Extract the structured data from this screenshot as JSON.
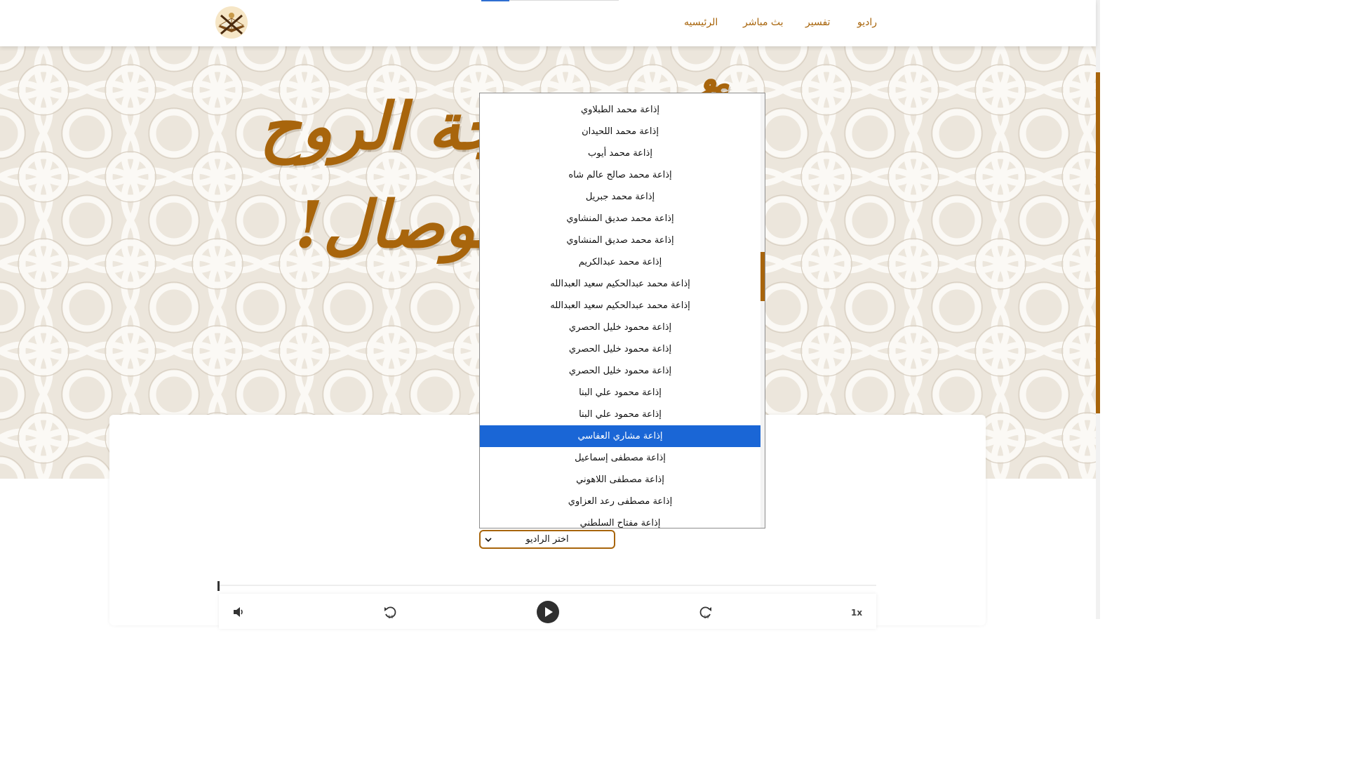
{
  "nav": {
    "items": [
      {
        "label": "راديو"
      },
      {
        "label": "تفسير"
      },
      {
        "label": "بث مباشر"
      },
      {
        "label": "الرئيسيه"
      }
    ]
  },
  "hero": {
    "line1": "أيُّها المُهجة الروح",
    "line2": "وا للوصال!"
  },
  "select": {
    "label": "اختر الراديو"
  },
  "dropdown": {
    "options": [
      "إذاعة محمد الطبلاوي",
      "إذاعة محمد اللحيدان",
      "إذاعة محمد أيوب",
      "إذاعة محمد صالح عالم شاه",
      "إذاعة محمد جبريل",
      "إذاعة محمد صديق المنشاوي",
      "إذاعة محمد صديق المنشاوي",
      "إذاعة محمد عبدالكريم",
      "إذاعة محمد عبدالحكيم سعيد العبدالله",
      "إذاعة محمد عبدالحكيم سعيد العبدالله",
      "إذاعة محمود خليل الحصري",
      "إذاعة محمود خليل الحصري",
      "إذاعة محمود خليل الحصري",
      "إذاعة محمود علي البنا",
      "إذاعة محمود علي البنا",
      "إذاعة مشاري العفاسي",
      "إذاعة مصطفى إسماعيل",
      "إذاعة مصطفى اللاهوني",
      "إذاعة مصطفى رعد العزاوي",
      "إذاعة مفتاح السلطني"
    ],
    "selected_index": 15
  },
  "player": {
    "speed": "1x",
    "icons": [
      "volume-icon",
      "rewind-10-icon",
      "play-icon",
      "forward-10-icon"
    ]
  },
  "colors": {
    "accent": "#a8650c",
    "selected": "#1a66d6",
    "hero_bg": "#ece6dc"
  }
}
